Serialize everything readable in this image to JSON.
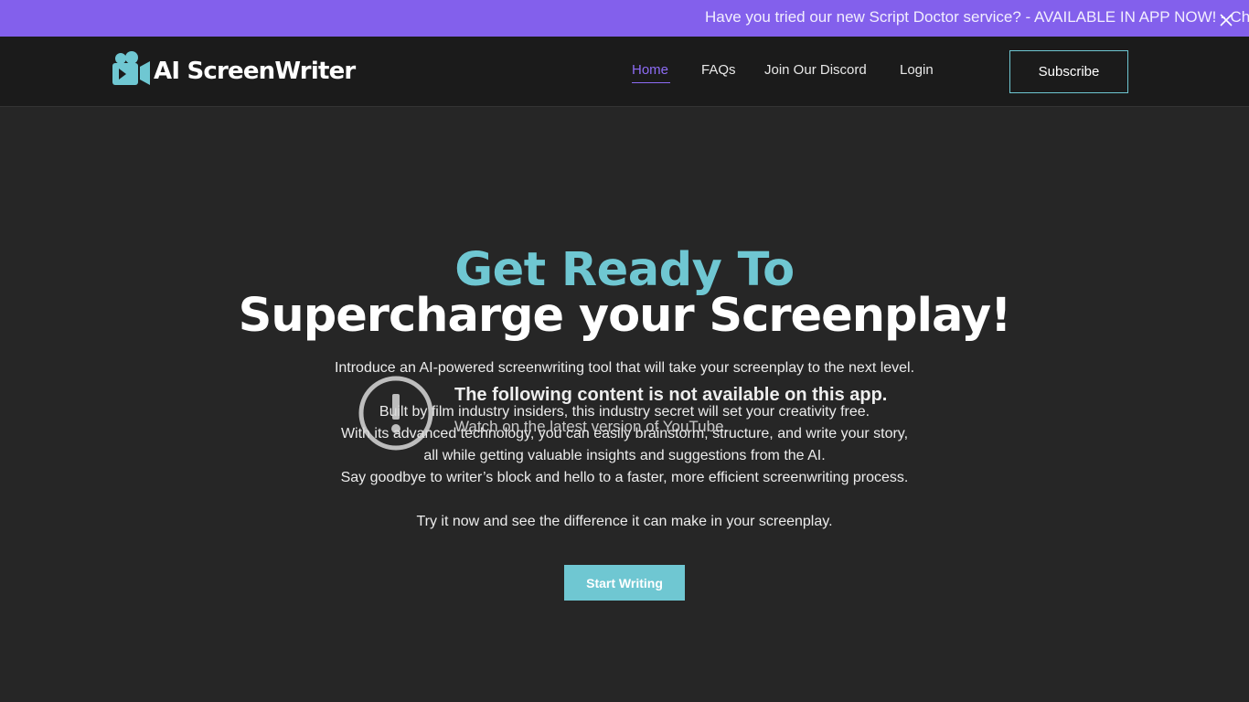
{
  "announcement": {
    "text": "Have you tried our new Script Doctor service? -  AVAILABLE IN APP NOW! - Chat",
    "close_icon": "close-icon"
  },
  "header": {
    "logo_text": "AI ScreenWriter",
    "logo_icon": "film-camera-icon",
    "nav": [
      {
        "label": "Home",
        "active": true
      },
      {
        "label": "FAQs",
        "active": false
      },
      {
        "label": "Join Our Discord",
        "active": false
      },
      {
        "label": "Login",
        "active": false
      }
    ],
    "subscribe_label": "Subscribe"
  },
  "hero": {
    "title_line1": "Get Ready To",
    "title_line2": "Supercharge your Screenplay!",
    "paragraphs": [
      "Introduce an AI-powered screenwriting tool that will take your screenplay to the next level.",
      "Built by film industry insiders, this industry secret will set your creativity free.",
      "With its advanced technology, you can easily brainstorm, structure, and write your story,",
      "all while getting valuable insights and suggestions from the AI.",
      "Say goodbye to writer’s block and hello to a faster, more efficient screenwriting process.",
      "Try it now and see the difference it can make in your screenplay."
    ],
    "cta_label": "Start Writing"
  },
  "video_overlay": {
    "icon": "alert-icon",
    "line1": "The following content is not available on this app.",
    "line2": "Watch on the latest version of YouTube."
  },
  "colors": {
    "announcement_bg": "#8360ec",
    "header_bg": "#1b1b1b",
    "page_bg": "#262626",
    "accent_teal": "#6fc7d2",
    "accent_purple": "#8d6cf5"
  }
}
